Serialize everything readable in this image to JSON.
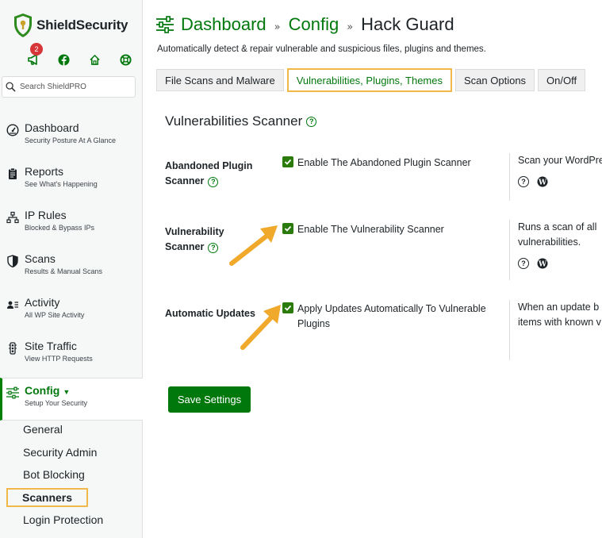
{
  "brand": {
    "name": "ShieldSecurity",
    "accent": "#00780c",
    "highlight": "#f0b849"
  },
  "top_icons": [
    {
      "icon": "megaphone-icon",
      "badge": "2"
    },
    {
      "icon": "facebook-icon"
    },
    {
      "icon": "home-icon"
    },
    {
      "icon": "lifebuoy-icon"
    }
  ],
  "search": {
    "placeholder": "Search ShieldPRO"
  },
  "nav": [
    {
      "title": "Dashboard",
      "subtitle": "Security Posture At A Glance",
      "icon": "gauge-icon"
    },
    {
      "title": "Reports",
      "subtitle": "See What's Happening",
      "icon": "clipboard-icon"
    },
    {
      "title": "IP Rules",
      "subtitle": "Blocked & Bypass IPs",
      "icon": "network-icon"
    },
    {
      "title": "Scans",
      "subtitle": "Results & Manual Scans",
      "icon": "shield-icon"
    },
    {
      "title": "Activity",
      "subtitle": "All WP Site Activity",
      "icon": "person-list-icon"
    },
    {
      "title": "Site Traffic",
      "subtitle": "View HTTP Requests",
      "icon": "traffic-light-icon"
    },
    {
      "title": "Config",
      "subtitle": "Setup Your Security",
      "icon": "sliders-icon",
      "active": true
    }
  ],
  "subnav": [
    "General",
    "Security Admin",
    "Bot Blocking",
    "Scanners",
    "Login Protection"
  ],
  "subnav_current": "Scanners",
  "breadcrumb": {
    "first": "Dashboard",
    "second": "Config",
    "sep": "»",
    "current": "Hack Guard"
  },
  "subtitle": "Automatically detect & repair vulnerable and suspicious files, plugins and themes.",
  "tabs": [
    {
      "label": "File Scans and Malware"
    },
    {
      "label": "Vulnerabilities, Plugins, Themes",
      "active": true
    },
    {
      "label": "Scan Options"
    },
    {
      "label": "On/Off"
    }
  ],
  "section_title": "Vulnerabilities Scanner",
  "options": [
    {
      "label_line1": "Abandoned Plugin",
      "label_line2": "Scanner",
      "checkbox": "Enable The Abandoned Plugin Scanner",
      "checked": true,
      "desc_line1": "Scan your WordPress",
      "desc_line2": ""
    },
    {
      "label_line1": "Vulnerability",
      "label_line2": "Scanner",
      "checkbox": "Enable The Vulnerability Scanner",
      "checked": true,
      "desc_line1": "Runs a scan of all",
      "desc_line2": "vulnerabilities."
    },
    {
      "label_line1": "Automatic Updates",
      "label_line2": "",
      "checkbox": "Apply Updates Automatically To Vulnerable Plugins",
      "checked": true,
      "desc_line1": "When an update b",
      "desc_line2": "items with known v"
    }
  ],
  "save_label": "Save Settings"
}
